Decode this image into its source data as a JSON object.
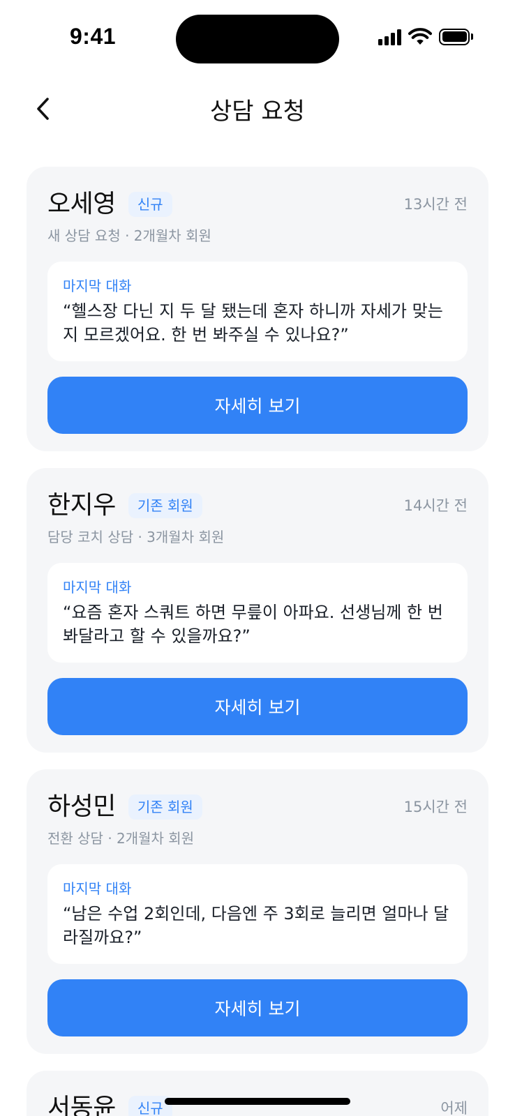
{
  "status_bar": {
    "time": "9:41",
    "icons": [
      "signal-icon",
      "wifi-icon",
      "battery-icon"
    ]
  },
  "header": {
    "back_icon": "chevron-left-icon",
    "title": "상담 요청"
  },
  "colors": {
    "accent": "#3182f6",
    "badge_bg": "#eaf2fe",
    "card_bg": "#f5f6f8",
    "muted_text": "#8b95a1"
  },
  "requests": [
    {
      "name": "오세영",
      "badge": "신규",
      "time": "13시간 전",
      "subtitle": "새 상담 요청 · 2개월차 회원",
      "message_label": "마지막 대화",
      "message": "“헬스장 다닌 지 두 달 됐는데 혼자 하니까 자세가 맞는지 모르겠어요. 한 번 봐주실 수 있나요?”",
      "button_label": "자세히 보기"
    },
    {
      "name": "한지우",
      "badge": "기존 회원",
      "time": "14시간 전",
      "subtitle": "담당 코치 상담 · 3개월차 회원",
      "message_label": "마지막 대화",
      "message": "“요즘 혼자 스쿼트 하면 무릎이 아파요. 선생님께 한 번 봐달라고 할 수 있을까요?”",
      "button_label": "자세히 보기"
    },
    {
      "name": "하성민",
      "badge": "기존 회원",
      "time": "15시간 전",
      "subtitle": "전환 상담 · 2개월차 회원",
      "message_label": "마지막 대화",
      "message": "“남은 수업 2회인데, 다음엔 주 3회로 늘리면 얼마나 달라질까요?”",
      "button_label": "자세히 보기"
    },
    {
      "name": "서동윤",
      "badge": "신규",
      "time": "어제"
    }
  ]
}
